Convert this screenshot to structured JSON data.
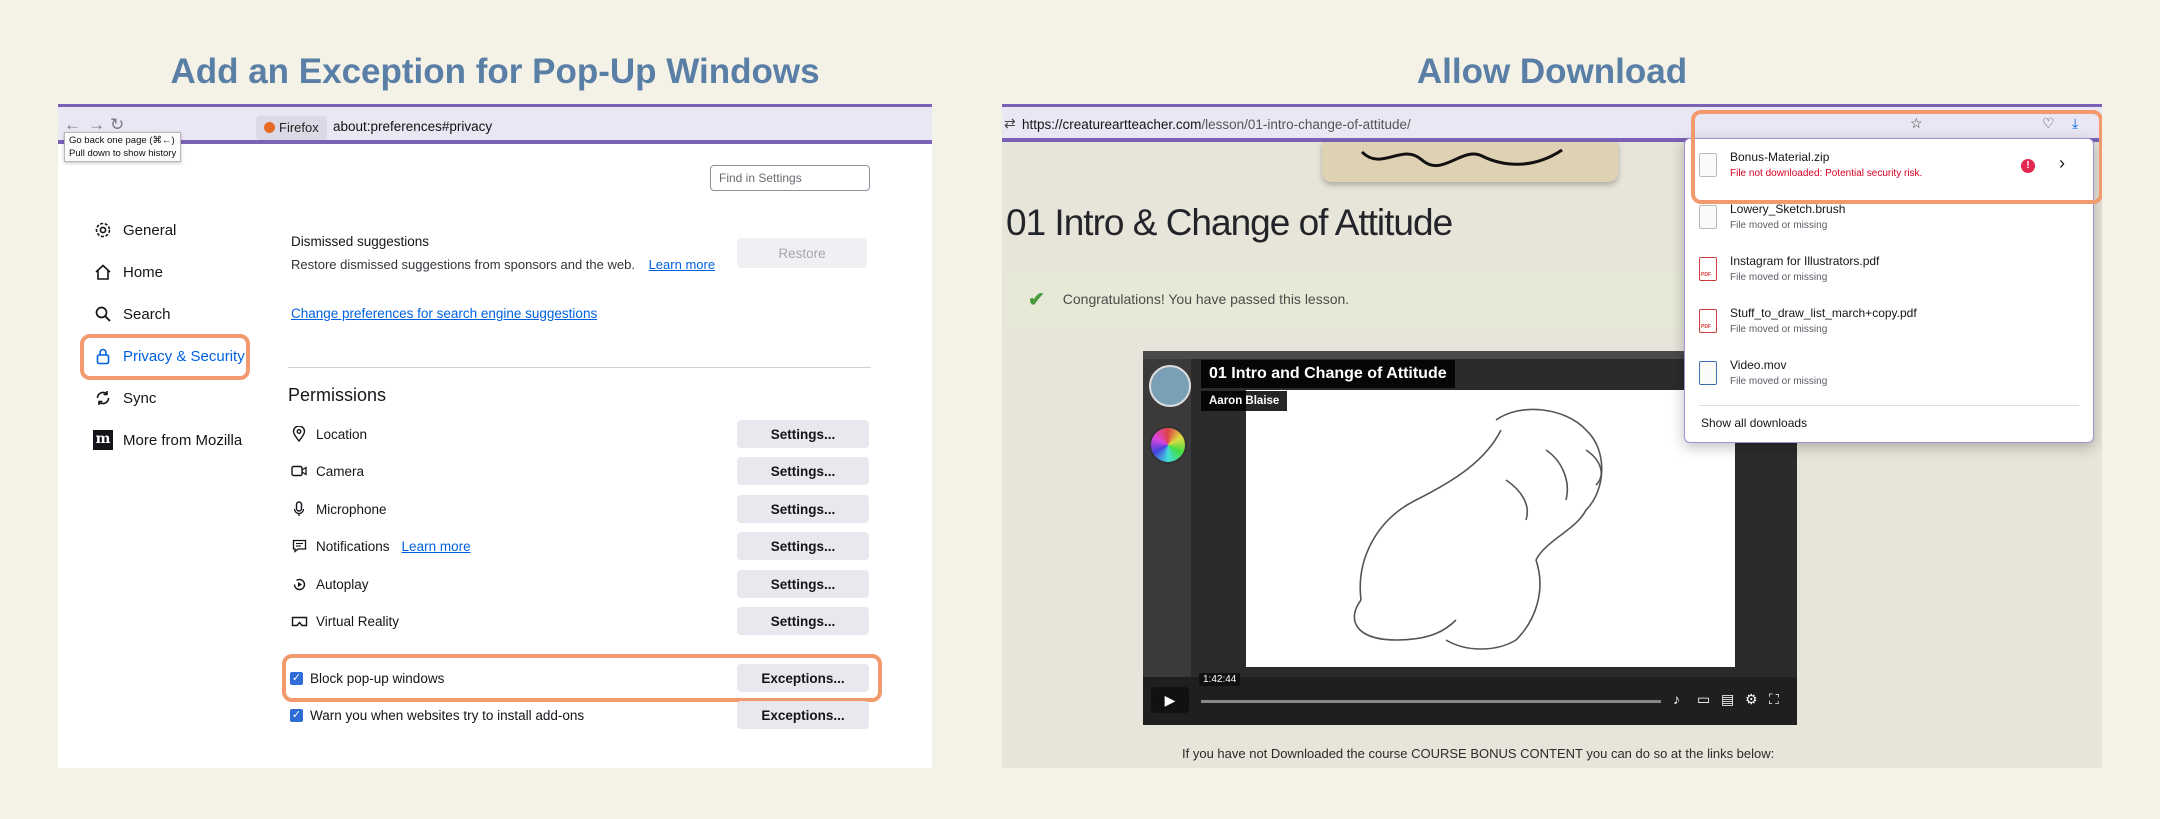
{
  "left": {
    "heading": "Add an Exception for Pop-Up Windows",
    "tooltip": {
      "line1": "Go back one page (⌘←)",
      "line2": "Pull down to show history"
    },
    "browser_chip": "Firefox",
    "url": "about:preferences#privacy",
    "find_placeholder": "Find in Settings",
    "sidebar": [
      {
        "label": "General",
        "icon": "gear-icon"
      },
      {
        "label": "Home",
        "icon": "home-icon"
      },
      {
        "label": "Search",
        "icon": "search-icon"
      },
      {
        "label": "Privacy & Security",
        "icon": "lock-icon"
      },
      {
        "label": "Sync",
        "icon": "sync-icon"
      },
      {
        "label": "More from Mozilla",
        "icon": "mozilla-icon"
      }
    ],
    "dismissed": {
      "title": "Dismissed suggestions",
      "desc": "Restore dismissed suggestions from sponsors and the web.",
      "learn_more": "Learn more",
      "restore": "Restore"
    },
    "change_prefs_link": "Change preferences for search engine suggestions",
    "permissions": {
      "title": "Permissions",
      "items": [
        {
          "label": "Location",
          "button": "Settings..."
        },
        {
          "label": "Camera",
          "button": "Settings..."
        },
        {
          "label": "Microphone",
          "button": "Settings..."
        },
        {
          "label": "Notifications",
          "button": "Settings...",
          "learn_more": "Learn more"
        },
        {
          "label": "Autoplay",
          "button": "Settings..."
        },
        {
          "label": "Virtual Reality",
          "button": "Settings..."
        }
      ]
    },
    "block_popups": {
      "label": "Block pop-up windows",
      "button": "Exceptions..."
    },
    "warn_addons": {
      "label": "Warn you when websites try to install add-ons",
      "button": "Exceptions..."
    }
  },
  "right": {
    "heading": "Allow Download",
    "url_host": "https://creatureartteacher.com",
    "url_path": "/lesson/01-intro-change-of-attitude/",
    "lesson_title": "01 Intro & Change of Attitude",
    "congrats": "Congratulations! You have passed this lesson.",
    "video": {
      "title": "01 Intro and Change of Attitude",
      "author": "Aaron Blaise",
      "time": "1:42:44"
    },
    "bottom_note": "If you have not Downloaded the course COURSE BONUS CONTENT you can do so at the links below:",
    "downloads": {
      "items": [
        {
          "name": "Bonus-Material.zip",
          "status": "File not downloaded: Potential security risk.",
          "type": "zip"
        },
        {
          "name": "Lowery_Sketch.brush",
          "status": "File moved or missing",
          "type": "file"
        },
        {
          "name": "Instagram for Illustrators.pdf",
          "status": "File moved or missing",
          "type": "pdf"
        },
        {
          "name": "Stuff_to_draw_list_march+copy.pdf",
          "status": "File moved or missing",
          "type": "pdf"
        },
        {
          "name": "Video.mov",
          "status": "File moved or missing",
          "type": "mov"
        }
      ],
      "show_all": "Show all downloads"
    }
  }
}
